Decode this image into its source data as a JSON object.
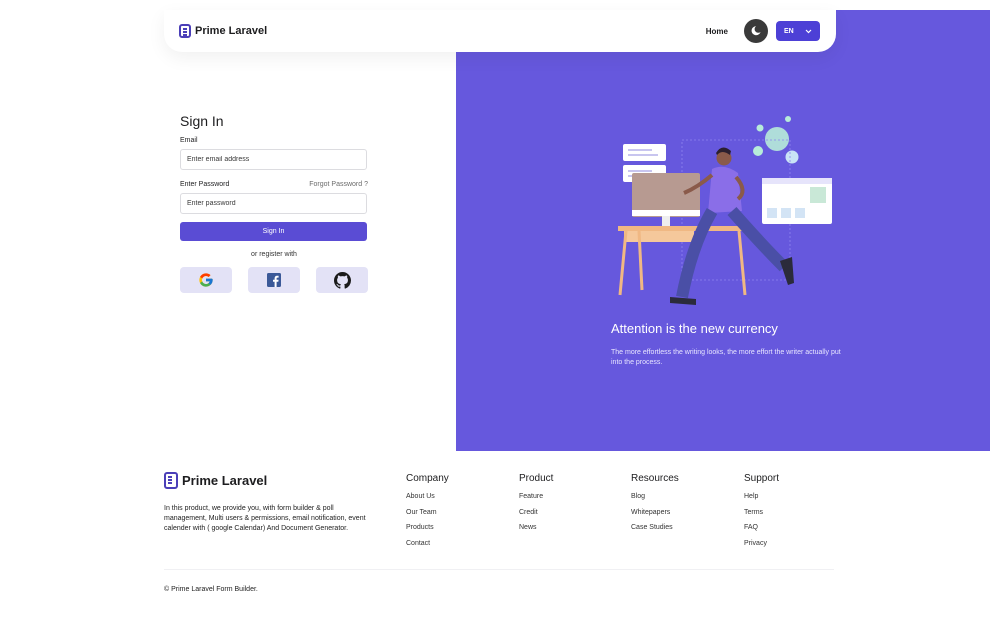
{
  "nav": {
    "brand": "Prime Laravel",
    "home": "Home",
    "lang": "EN"
  },
  "signin": {
    "title": "Sign In",
    "email_label": "Email",
    "email_placeholder": "Enter email address",
    "password_label": "Enter Password",
    "forgot": "Forgot Password ?",
    "password_placeholder": "Enter password",
    "submit": "Sign In",
    "or_register": "or register with",
    "social": [
      "google-icon",
      "facebook-icon",
      "github-icon"
    ]
  },
  "hero": {
    "title": "Attention is the new currency",
    "subtitle": "The more effortless the writing looks, the more effort the writer actually put into the process."
  },
  "footer": {
    "brand": "Prime Laravel",
    "description": "In this product, we provide you, with form builder & poll management, Multi users & permissions, email notification, event calender with ( google Calendar) And Document Generator.",
    "columns": [
      {
        "title": "Company",
        "links": [
          "About Us",
          "Our Team",
          "Products",
          "Contact"
        ]
      },
      {
        "title": "Product",
        "links": [
          "Feature",
          "Credit",
          "News"
        ]
      },
      {
        "title": "Resources",
        "links": [
          "Blog",
          "Whitepapers",
          "Case Studies"
        ]
      },
      {
        "title": "Support",
        "links": [
          "Help",
          "Terms",
          "FAQ",
          "Privacy"
        ]
      }
    ],
    "copyright": "© Prime Laravel Form Builder."
  },
  "colors": {
    "accent": "#6658dd",
    "button": "#5a4cd4"
  }
}
